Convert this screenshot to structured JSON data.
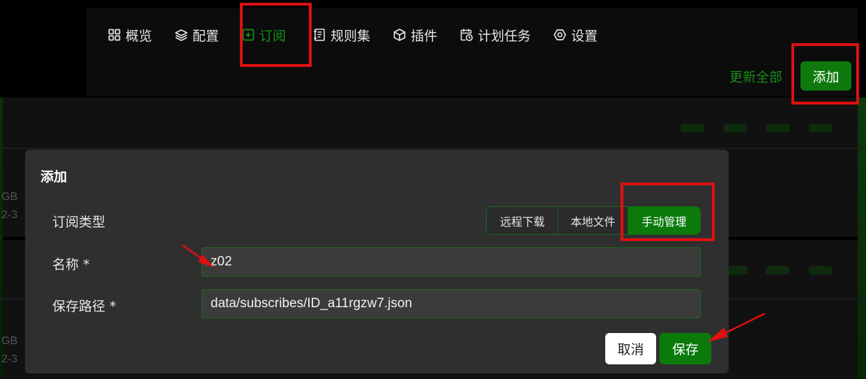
{
  "background": {
    "left_text_lines": [
      "GB",
      "2-3",
      "GB",
      "2-3"
    ]
  },
  "nav": {
    "items": [
      {
        "label": "概览",
        "icon": "dashboard-icon"
      },
      {
        "label": "配置",
        "icon": "layers-icon"
      },
      {
        "label": "订阅",
        "icon": "add-square-icon",
        "active": true
      },
      {
        "label": "规则集",
        "icon": "scroll-icon"
      },
      {
        "label": "插件",
        "icon": "cube-icon"
      },
      {
        "label": "计划任务",
        "icon": "calendar-clock-icon"
      },
      {
        "label": "设置",
        "icon": "settings-icon"
      }
    ],
    "update_all_label": "更新全部",
    "add_label": "添加"
  },
  "modal": {
    "title": "添加",
    "subscription_type_label": "订阅类型",
    "type_options": [
      "远程下载",
      "本地文件",
      "手动管理"
    ],
    "selected_type": "手动管理",
    "name_label": "名称 *",
    "name_value": "z02",
    "path_label": "保存路径 *",
    "path_value": "data/subscribes/ID_a11rgzw7.json",
    "cancel_label": "取消",
    "save_label": "保存"
  },
  "colors": {
    "accent_green": "#0b7a0b",
    "active_nav_green": "#179217",
    "annotation_red": "#e01010",
    "modal_bg": "#2f2f2f"
  }
}
